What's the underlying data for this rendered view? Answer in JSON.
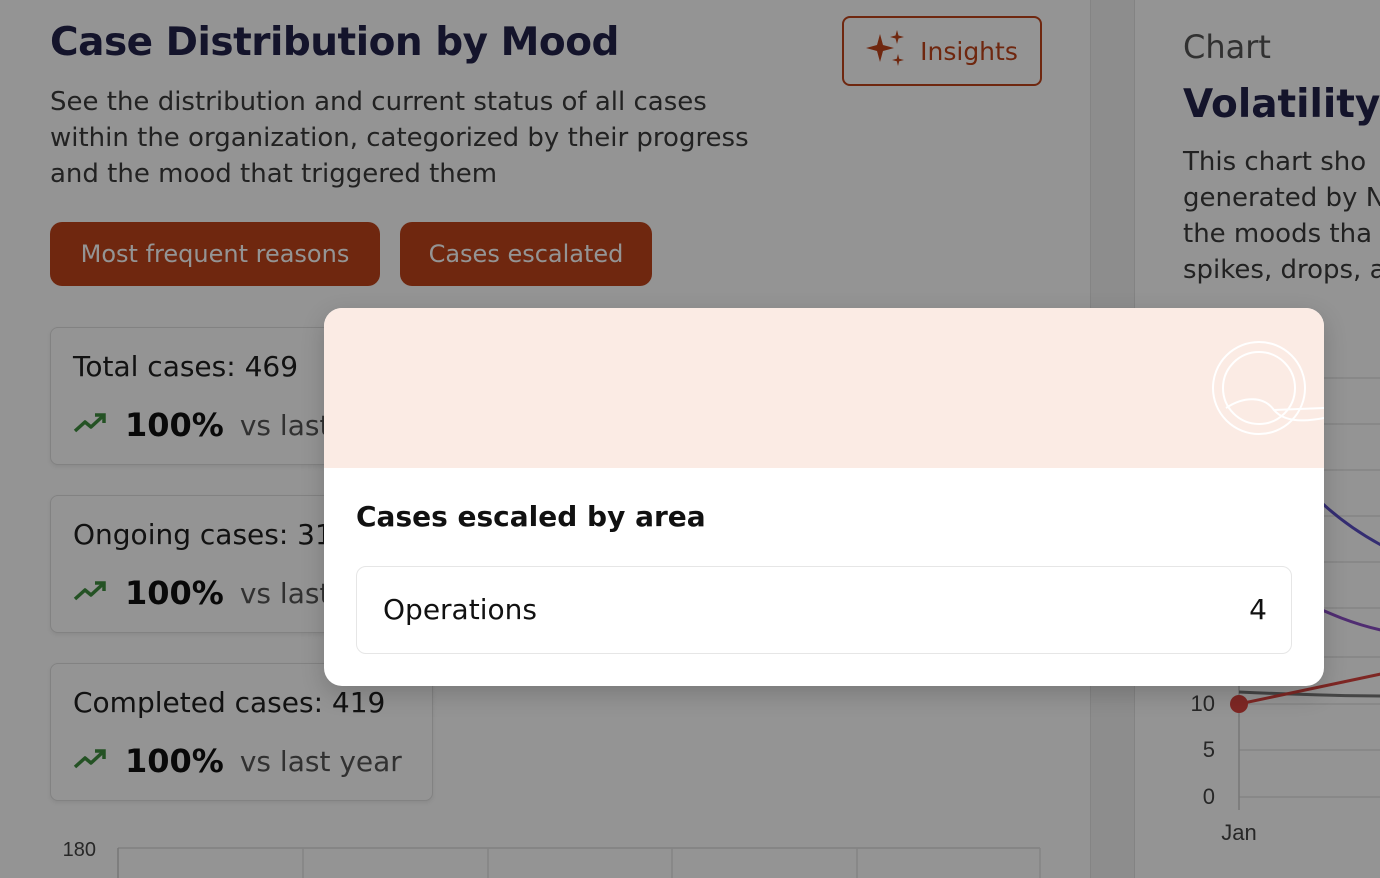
{
  "left": {
    "title": "Case Distribution by Mood",
    "subtitle": "See the distribution and current status of all cases within the organization, categorized by their progress and the mood that triggered them",
    "insights_button": {
      "label": "Insights",
      "icon": "sparkles-icon"
    },
    "filter_buttons": [
      "Most frequent reasons",
      "Cases escalated"
    ],
    "stats": [
      {
        "label": "Total cases: 469",
        "pct": "100%",
        "vs": "vs last"
      },
      {
        "label": "Ongoing cases: 31",
        "pct": "100%",
        "vs": "vs last"
      },
      {
        "label": "Completed cases: 419",
        "pct": "100%",
        "vs": "vs last year"
      }
    ],
    "bottom_chart_tick": "180"
  },
  "right": {
    "overline": "Chart",
    "title": "Volatility o",
    "description": "This chart sho\ngenerated by N\nthe moods tha\nspikes, drops, a"
  },
  "chart_data": {
    "type": "line",
    "yticks": [
      "10",
      "5",
      "0"
    ],
    "x": [
      "Jan"
    ],
    "series": [
      {
        "color": "#d9443f",
        "values": [
          10
        ]
      }
    ]
  },
  "modal": {
    "title": "Cases escaled by area",
    "rows": [
      {
        "area": "Operations",
        "count": "4"
      }
    ]
  },
  "colors": {
    "brand": "#c0441b",
    "trend_up": "#3e8e3e",
    "modal_header": "#fbebe4"
  }
}
